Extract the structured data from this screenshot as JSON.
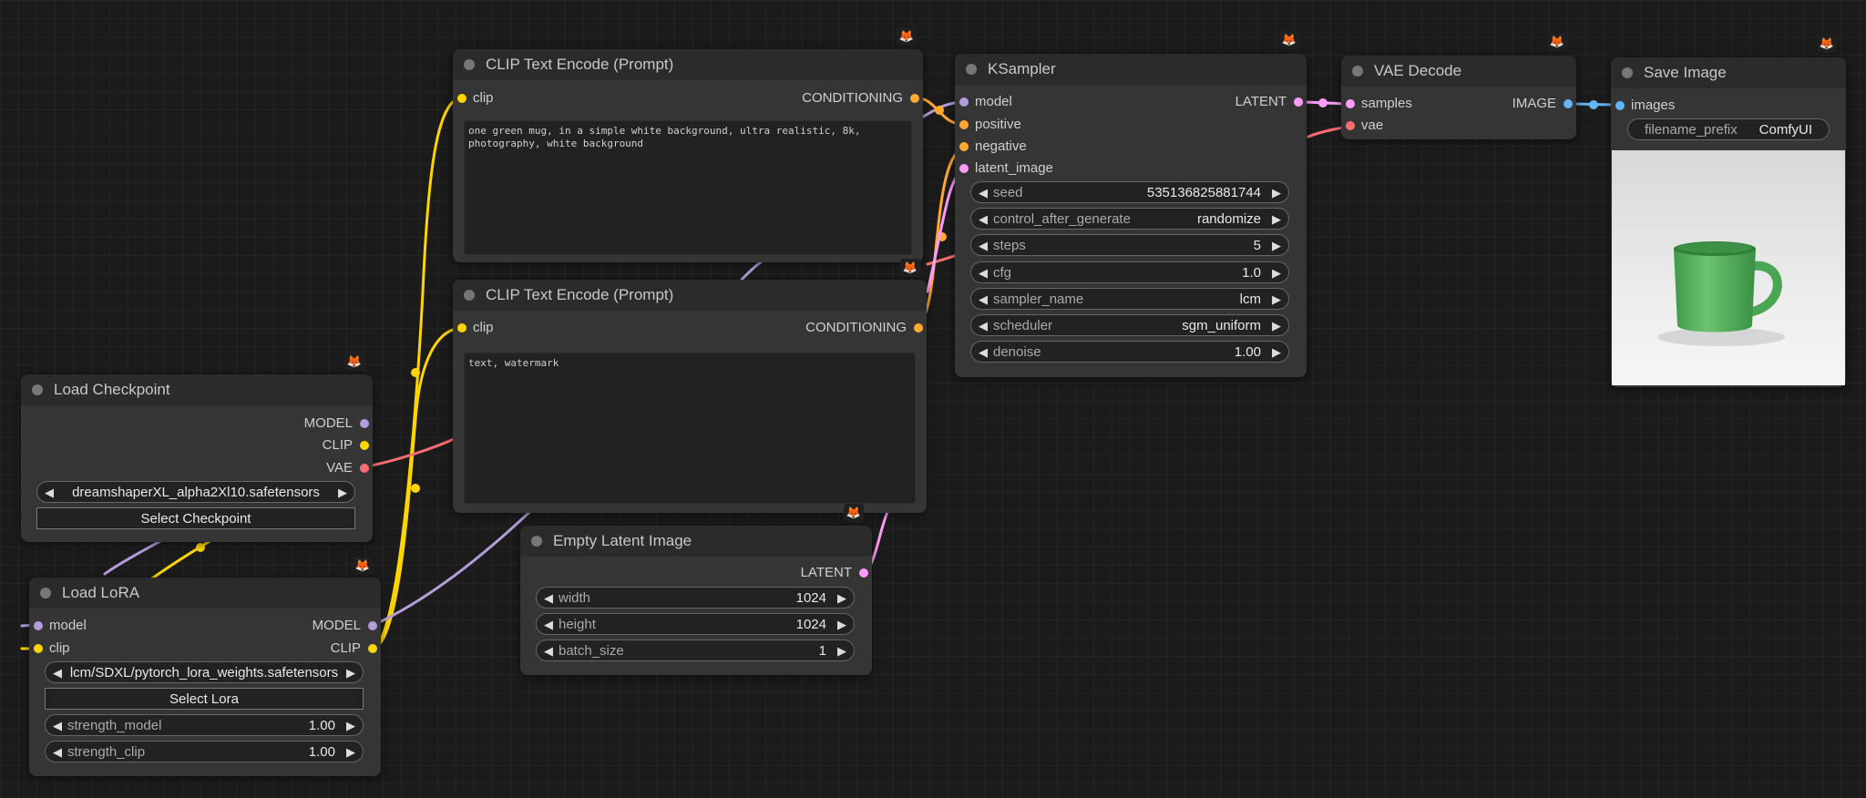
{
  "colors": {
    "canvas": "#1b1b1b",
    "node_body": "#353535",
    "node_title": "#2b2b2b",
    "model": "#b39ddb",
    "clip": "#ffd500",
    "vae": "#ff6e6e",
    "conditioning": "#ffa931",
    "latent": "#ff9cf9",
    "image": "#64b5f6"
  },
  "badge_icon": "fox-icon",
  "nodes": {
    "load_checkpoint": {
      "title": "Load Checkpoint",
      "outputs": [
        "MODEL",
        "CLIP",
        "VAE"
      ],
      "ckpt_name": "dreamshaperXL_alpha2Xl10.safetensors",
      "button": "Select Checkpoint"
    },
    "load_lora": {
      "title": "Load LoRA",
      "inputs": [
        "model",
        "clip"
      ],
      "outputs": [
        "MODEL",
        "CLIP"
      ],
      "lora_name": "lcm/SDXL/pytorch_lora_weights.safetensors",
      "button": "Select Lora",
      "widgets": [
        {
          "label": "strength_model",
          "value": "1.00"
        },
        {
          "label": "strength_clip",
          "value": "1.00"
        }
      ]
    },
    "clip_pos": {
      "title": "CLIP Text Encode (Prompt)",
      "input": "clip",
      "output": "CONDITIONING",
      "text": "one green mug, in a simple white background, ultra realistic, 8k, photography, white background"
    },
    "clip_neg": {
      "title": "CLIP Text Encode (Prompt)",
      "input": "clip",
      "output": "CONDITIONING",
      "text": "text, watermark"
    },
    "empty_latent": {
      "title": "Empty Latent Image",
      "output": "LATENT",
      "widgets": [
        {
          "label": "width",
          "value": "1024"
        },
        {
          "label": "height",
          "value": "1024"
        },
        {
          "label": "batch_size",
          "value": "1"
        }
      ]
    },
    "ksampler": {
      "title": "KSampler",
      "inputs": [
        "model",
        "positive",
        "negative",
        "latent_image"
      ],
      "output": "LATENT",
      "widgets": [
        {
          "label": "seed",
          "value": "535136825881744"
        },
        {
          "label": "control_after_generate",
          "value": "randomize"
        },
        {
          "label": "steps",
          "value": "5"
        },
        {
          "label": "cfg",
          "value": "1.0"
        },
        {
          "label": "sampler_name",
          "value": "lcm"
        },
        {
          "label": "scheduler",
          "value": "sgm_uniform"
        },
        {
          "label": "denoise",
          "value": "1.00"
        }
      ]
    },
    "vae_decode": {
      "title": "VAE Decode",
      "inputs": [
        "samples",
        "vae"
      ],
      "output": "IMAGE"
    },
    "save_image": {
      "title": "Save Image",
      "input": "images",
      "filename_prefix_label": "filename_prefix",
      "filename_prefix_value": "ComfyUI",
      "preview": "green mug on white background"
    }
  }
}
